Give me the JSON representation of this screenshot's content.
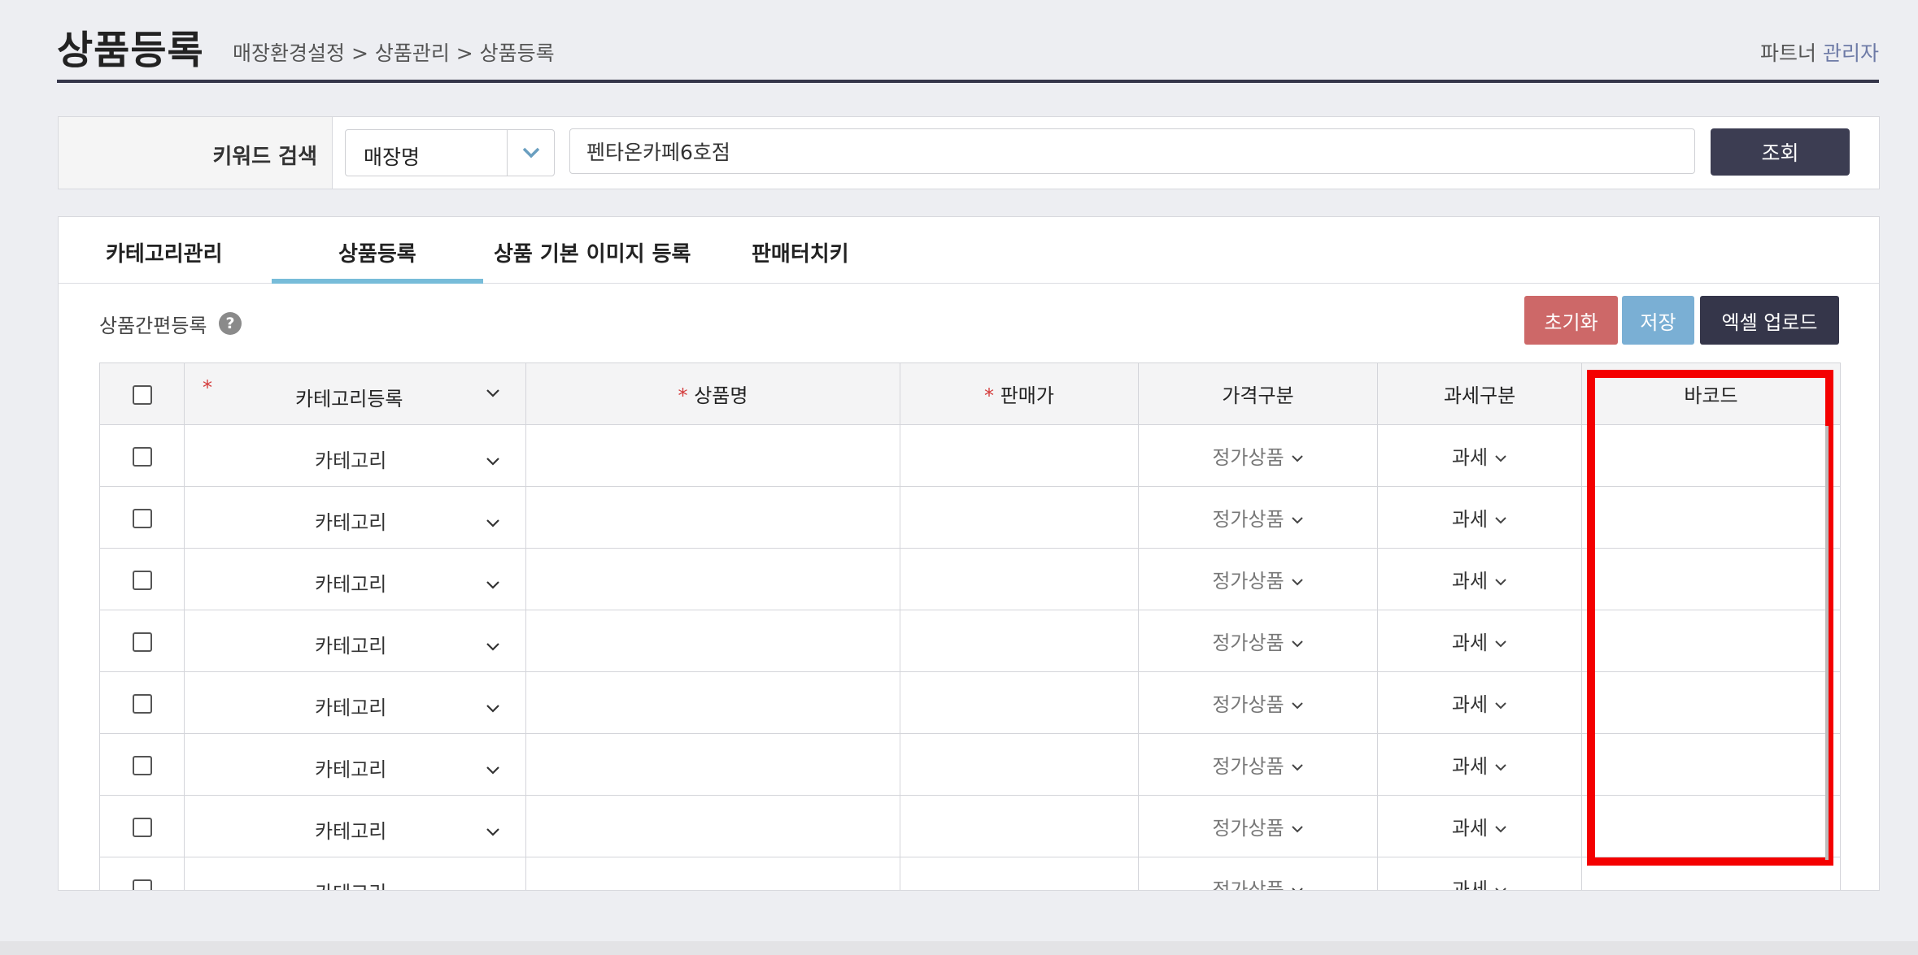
{
  "header": {
    "title": "상품등록",
    "breadcrumb": "매장환경설정 > 상품관리 > 상품등록",
    "account_prefix": "파트너",
    "account_role": "관리자"
  },
  "search": {
    "label": "키워드 검색",
    "select_value": "매장명",
    "input_value": "펜타온카페6호점",
    "button_label": "조회"
  },
  "tabs": [
    {
      "label": "카테고리관리",
      "active": false
    },
    {
      "label": "상품등록",
      "active": true
    },
    {
      "label": "상품 기본 이미지 등록",
      "active": false
    },
    {
      "label": "판매터치키",
      "active": false
    }
  ],
  "section": {
    "label": "상품간편등록",
    "help_icon_glyph": "?"
  },
  "buttons": {
    "reset": "초기화",
    "save": "저장",
    "excel": "엑셀 업로드"
  },
  "table": {
    "required_mark": "*",
    "headers": {
      "category": "카테고리등록",
      "name": "상품명",
      "price": "판매가",
      "price_type": "가격구분",
      "tax_type": "과세구분",
      "barcode": "바코드"
    },
    "rows": [
      {
        "category": "카테고리",
        "price_type": "정가상품",
        "tax": "과세"
      },
      {
        "category": "카테고리",
        "price_type": "정가상품",
        "tax": "과세"
      },
      {
        "category": "카테고리",
        "price_type": "정가상품",
        "tax": "과세"
      },
      {
        "category": "카테고리",
        "price_type": "정가상품",
        "tax": "과세"
      },
      {
        "category": "카테고리",
        "price_type": "정가상품",
        "tax": "과세"
      },
      {
        "category": "카테고리",
        "price_type": "정가상품",
        "tax": "과세"
      },
      {
        "category": "카테고리",
        "price_type": "정가상품",
        "tax": "과세"
      },
      {
        "category": "카테고리",
        "price_type": "정가상품",
        "tax": "과세"
      }
    ]
  },
  "colors": {
    "highlight": "#f40000",
    "tab_active": "#77bcd9",
    "primary_dark": "#35364a",
    "reset": "#cd6868",
    "save": "#7aafd4"
  }
}
